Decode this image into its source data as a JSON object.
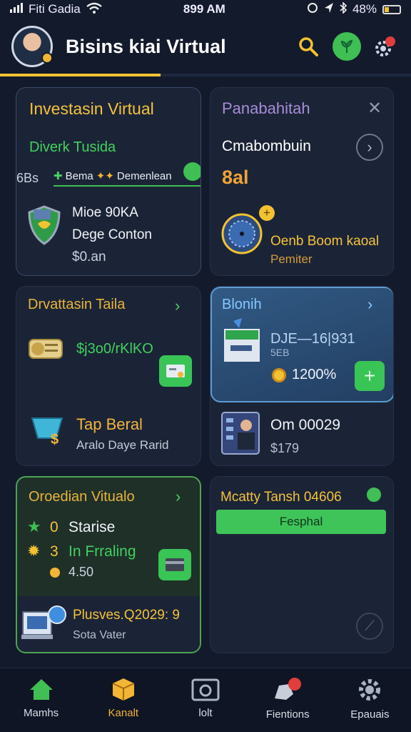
{
  "status": {
    "carrier": "Fiti Gadia",
    "time": "899 AM",
    "battery": "48%"
  },
  "header": {
    "title": "Bisins kiai Virtual",
    "progress": 0.39
  },
  "card1": {
    "title": "Investasin Virtual",
    "subtitle": "Diverk Tusida",
    "promo_prefix": "6Bs",
    "promo_a": "Bema",
    "promo_b": "Demenlean",
    "line1": "Mioe 90KA",
    "line2": "Dege Conton",
    "line3": "$0.an"
  },
  "card2": {
    "title": "Panabahitah",
    "heading": "Cmabombuin",
    "value": "8al",
    "line1": "Oenb Boom kaoal",
    "line2": "Pemiter"
  },
  "card3": {
    "title": "Drvattasin Taila",
    "amount": "$j3o0/rKlKO",
    "line1": "Tap Beral",
    "line2": "Aralo Daye Rarid"
  },
  "card4": {
    "title": "Blonih",
    "code1": "DJE—16|931",
    "code2": "5EB",
    "coins": "1200%",
    "name": "Om 00029",
    "price": "$179"
  },
  "card5": {
    "title": "Oroedian Vitualo",
    "row1_num": "0",
    "row1_text": "Starise",
    "row2_num": "3",
    "row2_text": "In Frraling",
    "row3": "4.50",
    "bottom_title": "Plusves.Q2029: 9",
    "bottom_sub": "Sota Vater"
  },
  "card6": {
    "title": "Mcatty Tansh 04606",
    "button": "Fesphal"
  },
  "nav": [
    {
      "label": "Mamhs",
      "icon": "home-icon"
    },
    {
      "label": "Kanalt",
      "icon": "box-icon"
    },
    {
      "label": "lolt",
      "icon": "camera-icon"
    },
    {
      "label": "Fientions",
      "icon": "hand-icon"
    },
    {
      "label": "Epauais",
      "icon": "gear-icon"
    }
  ],
  "colors": {
    "accent": "#f1c234",
    "green": "#3fbf54",
    "bg": "#131a2b"
  }
}
